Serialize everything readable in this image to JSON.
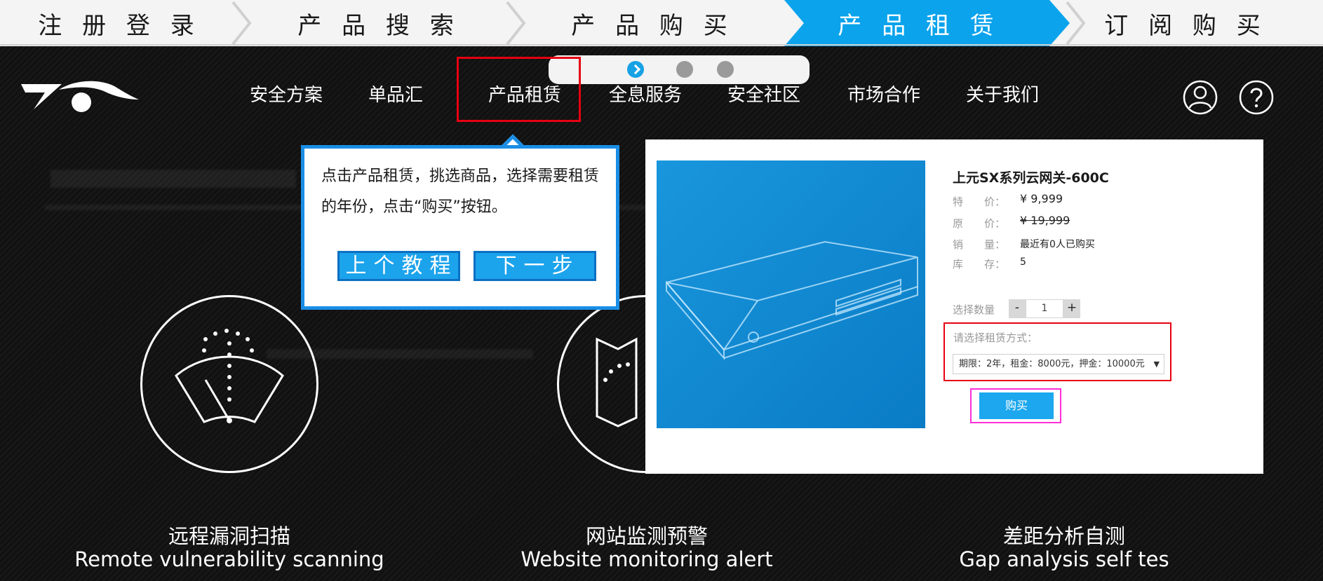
{
  "colors": {
    "step_active": "#0aa3ec",
    "highlight_red": "#e60012",
    "highlight_magenta": "#ff2fd9",
    "tooltip_border": "#1a8ee6",
    "button_blue": "#1ba3ec"
  },
  "steps": [
    {
      "label": "注 册 登 录",
      "active": false
    },
    {
      "label": "产 品 搜 索",
      "active": false
    },
    {
      "label": "产 品 购 买",
      "active": false
    },
    {
      "label": "产 品 租 赁",
      "active": true
    },
    {
      "label": "订 阅 购 买",
      "active": false
    }
  ],
  "nav": {
    "items": [
      "安全方案",
      "单品汇",
      "产品租赁",
      "全息服务",
      "安全社区",
      "市场合作",
      "关于我们"
    ],
    "icons": [
      "user-icon",
      "help-icon"
    ]
  },
  "carousel": {
    "dots": 3,
    "active_index": 0
  },
  "tooltip": {
    "text": "点击产品租赁，挑选商品，选择需要租赁的年份，点击“购买”按钮。",
    "prev_label": "上个教程",
    "next_label": "下一步"
  },
  "product": {
    "title": "上元SX系列云网关-600C",
    "rows": [
      {
        "label": "特　　价：",
        "value": "¥  9,999"
      },
      {
        "label": "原　　价：",
        "value": "¥  19,999"
      },
      {
        "label": "销　　量：",
        "value": "最近有0人已购买"
      },
      {
        "label": "库　　存：",
        "value": "5"
      }
    ],
    "qty_label": "选择数量",
    "qty_minus": "-",
    "qty_value": "1",
    "qty_plus": "+",
    "rent_label": "请选择租赁方式：",
    "rent_option": "期限：2年，租金：8000元，押金：10000元",
    "buy_label": "购买"
  },
  "features": [
    {
      "title": "远程漏洞扫描",
      "subtitle": "Remote vulnerability scanning"
    },
    {
      "title": "网站监测预警",
      "subtitle": "Website monitoring alert"
    },
    {
      "title": "差距分析自测",
      "subtitle": "Gap analysis self tes"
    }
  ]
}
